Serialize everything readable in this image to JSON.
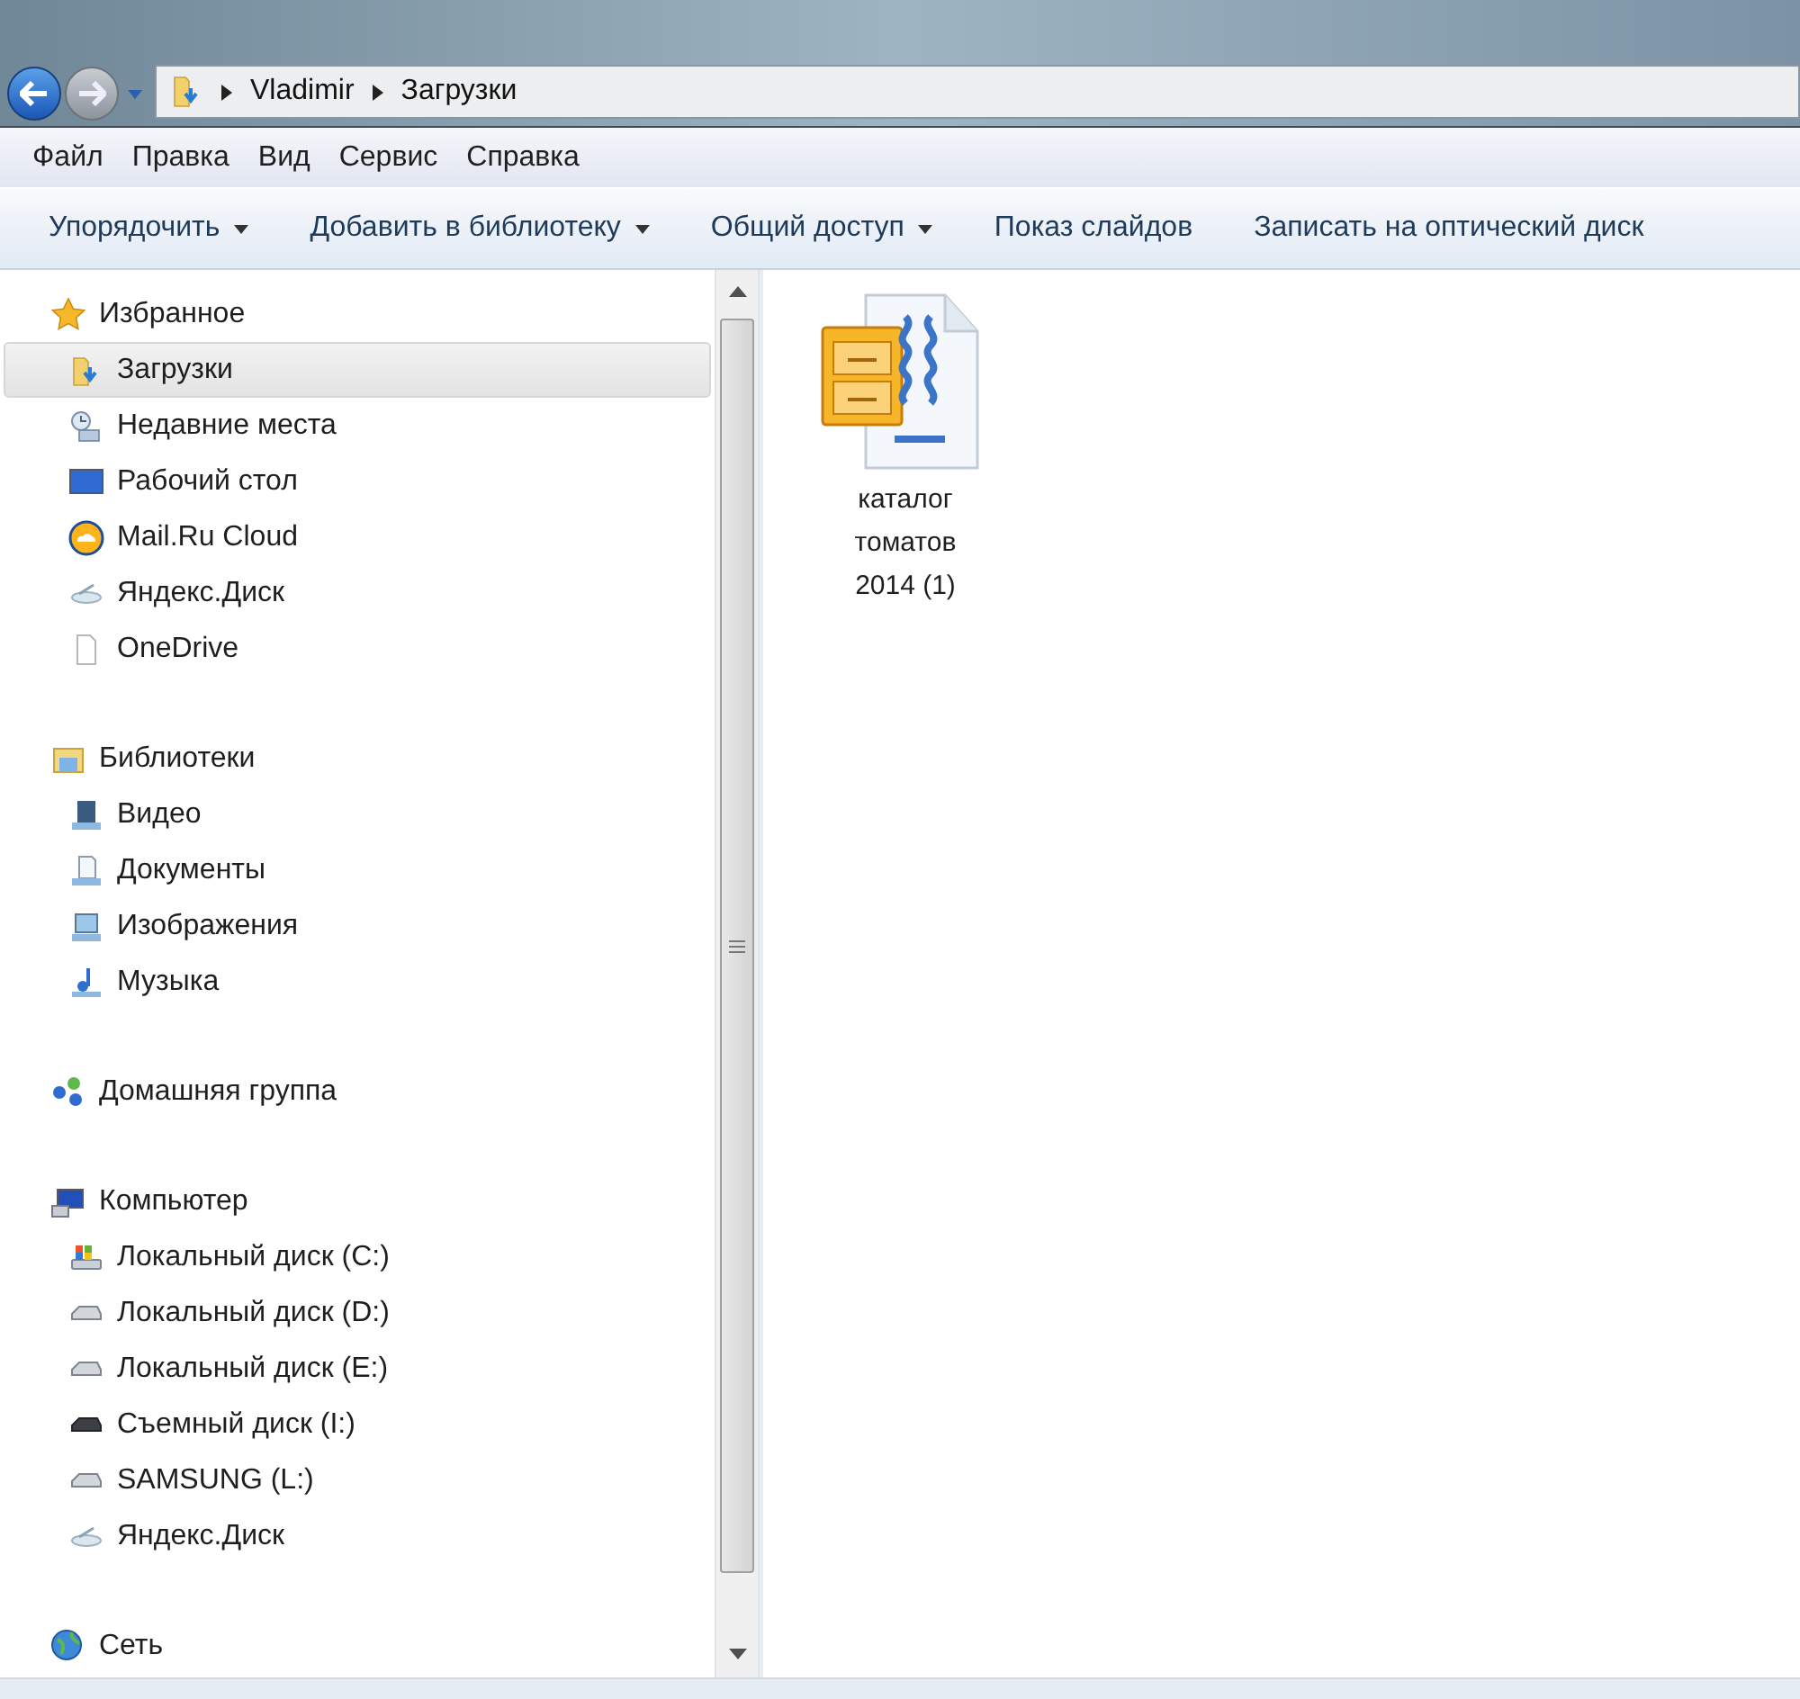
{
  "address_bar": {
    "path": [
      "Vladimir",
      "Загрузки"
    ]
  },
  "menu_bar": [
    "Файл",
    "Правка",
    "Вид",
    "Сервис",
    "Справка"
  ],
  "toolbar": [
    {
      "label": "Упорядочить",
      "dropdown": true
    },
    {
      "label": "Добавить в библиотеку",
      "dropdown": true
    },
    {
      "label": "Общий доступ",
      "dropdown": true
    },
    {
      "label": "Показ слайдов",
      "dropdown": false
    },
    {
      "label": "Записать на оптический диск",
      "dropdown": false
    }
  ],
  "navigation": [
    {
      "label": "Избранное",
      "kind": "star",
      "children": [
        {
          "label": "Загрузки",
          "kind": "downloads",
          "selected": true
        },
        {
          "label": "Недавние места",
          "kind": "recent",
          "selected": false
        },
        {
          "label": "Рабочий стол",
          "kind": "desktop",
          "selected": false
        },
        {
          "label": "Mail.Ru Cloud",
          "kind": "cloud",
          "selected": false
        },
        {
          "label": "Яндекс.Диск",
          "kind": "yandex",
          "selected": false
        },
        {
          "label": "OneDrive",
          "kind": "blank",
          "selected": false
        }
      ]
    },
    {
      "label": "Библиотеки",
      "kind": "library",
      "children": [
        {
          "label": "Видео",
          "kind": "video",
          "selected": false
        },
        {
          "label": "Документы",
          "kind": "documents",
          "selected": false
        },
        {
          "label": "Изображения",
          "kind": "pictures",
          "selected": false
        },
        {
          "label": "Музыка",
          "kind": "music",
          "selected": false
        }
      ]
    },
    {
      "label": "Домашняя группа",
      "kind": "homegroup"
    },
    {
      "label": "Компьютер",
      "kind": "computer",
      "children": [
        {
          "label": "Локальный диск (C:)",
          "kind": "systemdrive",
          "selected": false
        },
        {
          "label": "Локальный диск (D:)",
          "kind": "drive",
          "selected": false
        },
        {
          "label": "Локальный диск (E:)",
          "kind": "drive",
          "selected": false
        },
        {
          "label": "Съемный диск (I:)",
          "kind": "removable",
          "selected": false
        },
        {
          "label": "SAMSUNG (L:)",
          "kind": "drive",
          "selected": false
        },
        {
          "label": "Яндекс.Диск",
          "kind": "yandex",
          "selected": false
        }
      ]
    },
    {
      "label": "Сеть",
      "kind": "network"
    }
  ],
  "files": [
    {
      "name": "каталог томатов 2014 (1)",
      "kind": "archive"
    }
  ]
}
